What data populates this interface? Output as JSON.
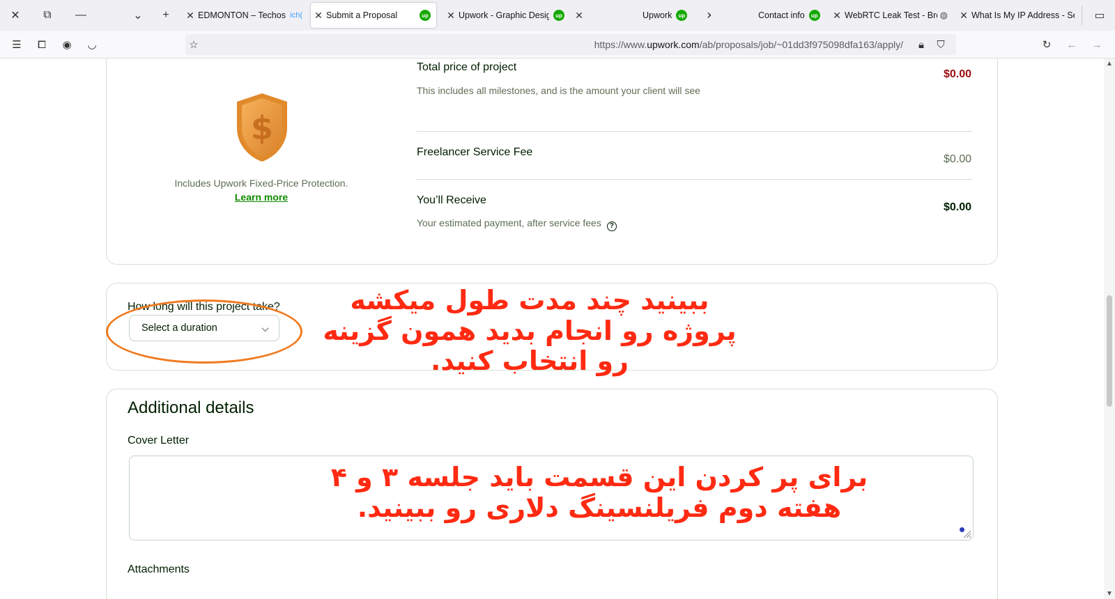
{
  "browser": {
    "tabs": [
      {
        "title": "EDMONTON – Techos",
        "extra": "ich(",
        "active": false,
        "upwork": false
      },
      {
        "title": "Submit a Proposal",
        "active": true,
        "upwork": true
      },
      {
        "title": "Upwork - Graphic Desig",
        "active": false,
        "upwork": true
      },
      {
        "title": "Upwork",
        "active": false,
        "upwork": true
      },
      {
        "title": "Contact info",
        "active": false,
        "upwork": true
      },
      {
        "title": "WebRTC Leak Test - Bro",
        "active": false,
        "upwork": false
      },
      {
        "title": "What Is My IP Address - Sea",
        "active": false,
        "upwork": false
      }
    ],
    "url_prefix": "https://www.",
    "url_domain": "upwork.com",
    "url_path": "/ab/proposals/job/~01dd3f975098dfa163/apply/"
  },
  "pricing": {
    "total_title": "Total price of project",
    "total_sub": "This includes all milestones, and is the amount your client will see",
    "total_value": "$0.00",
    "fee_title": "Freelancer Service Fee",
    "fee_value": "$0.00",
    "receive_title": "You’ll Receive",
    "receive_sub": "Your estimated payment, after service fees",
    "receive_value": "$0.00",
    "protection_text": "Includes Upwork Fixed-Price Protection.",
    "learn_more": "Learn more"
  },
  "duration": {
    "label": "How long will this project take?",
    "select_placeholder": "Select a duration"
  },
  "additional": {
    "title": "Additional details",
    "cover_label": "Cover Letter",
    "attachments_label": "Attachments"
  },
  "annotations": {
    "duration_note": [
      "ببینید چند مدت طول میکشه",
      "پروژه رو انجام بدید همون گزینه",
      "رو انتخاب کنید."
    ],
    "cover_note": [
      "برای پر کردن این قسمت باید جلسه ۳ و ۴",
      "هفته دوم فریلنسینگ دلاری رو ببینید."
    ]
  },
  "colors": {
    "brand_green": "#14a800",
    "link_green": "#108a00",
    "total_red": "#9b0d0d",
    "annotation_red": "#ff2a12",
    "annotation_orange": "#f07a20"
  }
}
